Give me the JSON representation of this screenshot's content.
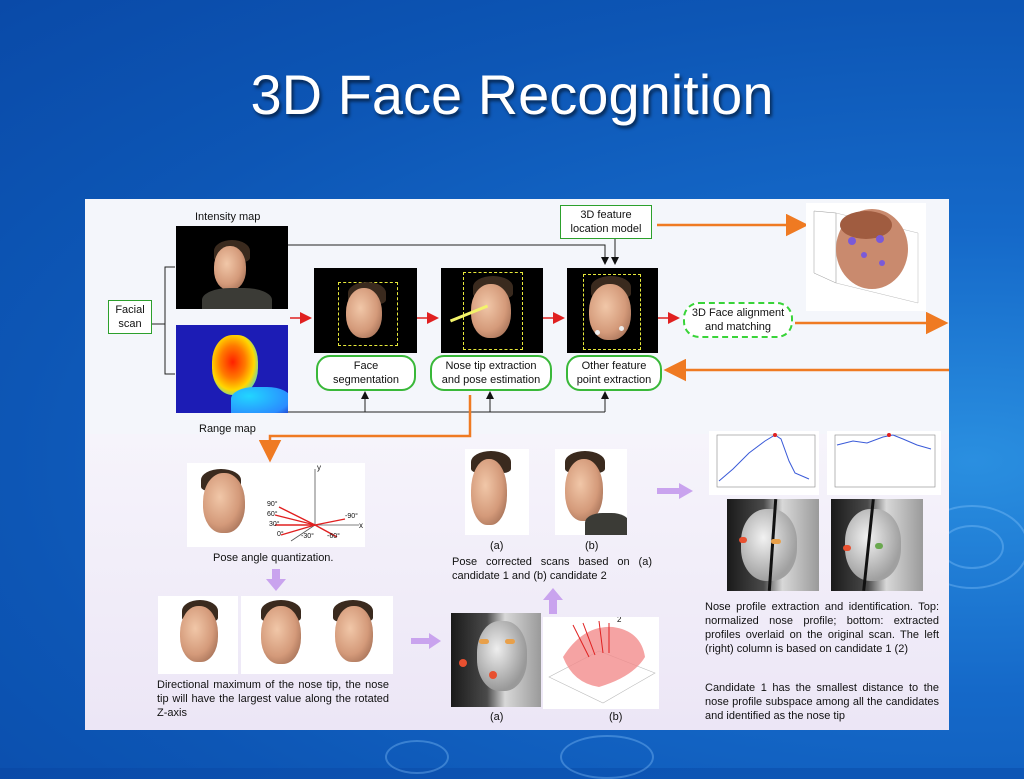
{
  "slide": {
    "title": "3D Face Recognition"
  },
  "flow": {
    "intensity_label": "Intensity map",
    "range_label": "Range map",
    "facial_scan": [
      "Facial",
      "scan"
    ],
    "feature_model": [
      "3D feature",
      "location model"
    ],
    "face_segmentation": [
      "Face",
      "segmentation"
    ],
    "nose_tip": [
      "Nose tip extraction",
      "and pose estimation"
    ],
    "other_feature": [
      "Other feature",
      "point extraction"
    ],
    "alignment": [
      "3D Face alignment",
      "and matching"
    ]
  },
  "lower": {
    "pose_quant": "Pose angle quantization.",
    "angles": [
      "90°",
      "60°",
      "30°",
      "0°",
      "-30°",
      "-60°",
      "-90°"
    ],
    "axis_y": "y",
    "axis_x": "x",
    "directional_note": "Directional maximum of the nose tip, the nose tip will have the largest value along the rotated Z-axis",
    "corrected_a": "(a)",
    "corrected_b": "(b)",
    "corrected_caption": "Pose corrected scans based on (a) candidate 1 and (b) candidate 2",
    "bottom_a": "(a)",
    "bottom_b": "(b)",
    "profile_note": "Nose profile extraction and identification. Top: normalized nose profile; bottom: extracted profiles overlaid on the original scan. The left (right) column is based on candidate 1 (2)",
    "candidate_note": "Candidate 1 has the smallest distance to the nose profile subspace among all the candidates and identified as the nose tip",
    "candidate_marker": "2"
  },
  "colors": {
    "background": "#1569c9",
    "title_text": "#ffffff",
    "green_outline": "#39b839",
    "orange_arrow": "#ef7a22",
    "red_arrow": "#e02020",
    "purple_arrow": "#c9a3ee"
  }
}
